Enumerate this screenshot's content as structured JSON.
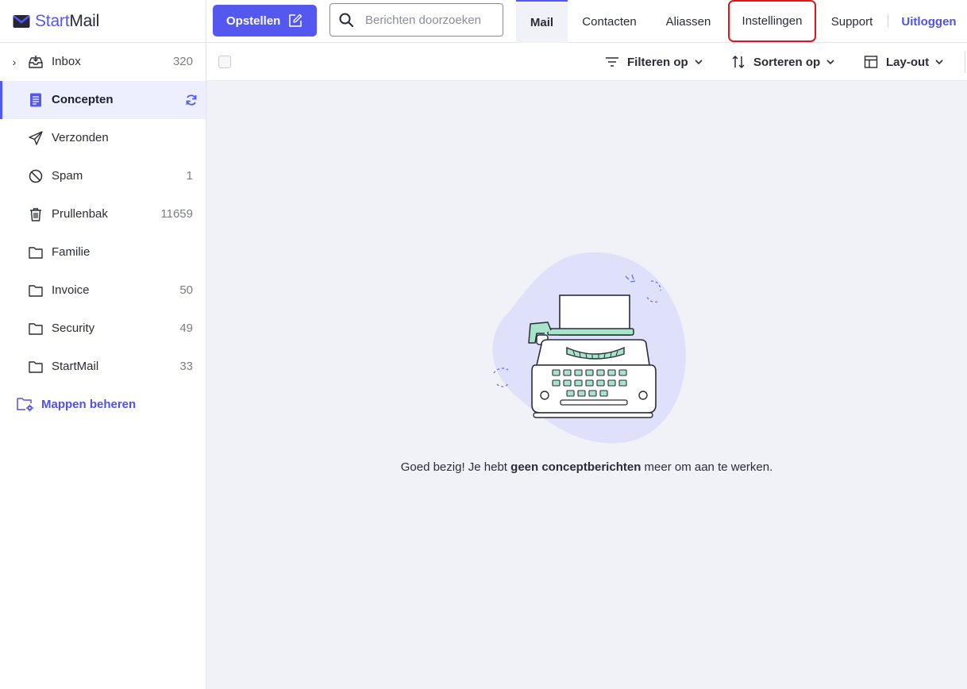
{
  "brand": {
    "name_part1": "Start",
    "name_part2": "Mail",
    "accent": "#5558ef"
  },
  "sidebar": {
    "folders": [
      {
        "label": "Inbox",
        "count": "320",
        "icon": "inbox-icon",
        "expandable": true
      },
      {
        "label": "Concepten",
        "count": "",
        "icon": "drafts-icon",
        "active": true,
        "status_icon": "sync-icon"
      },
      {
        "label": "Verzonden",
        "count": "",
        "icon": "send-icon"
      },
      {
        "label": "Spam",
        "count": "1",
        "icon": "spam-icon"
      },
      {
        "label": "Prullenbak",
        "count": "11659",
        "icon": "trash-icon"
      },
      {
        "label": "Familie",
        "count": "",
        "icon": "folder-icon"
      },
      {
        "label": "Invoice",
        "count": "50",
        "icon": "folder-icon"
      },
      {
        "label": "Security",
        "count": "49",
        "icon": "folder-icon"
      },
      {
        "label": "StartMail",
        "count": "33",
        "icon": "folder-icon"
      }
    ],
    "manage_label": "Mappen beheren"
  },
  "header": {
    "compose_label": "Opstellen",
    "search_placeholder": "Berichten doorzoeken",
    "tabs": {
      "mail": "Mail",
      "contacts": "Contacten",
      "aliases": "Aliassen",
      "settings": "Instellingen",
      "support": "Support",
      "logout": "Uitloggen"
    },
    "highlight_color": "#e0141c"
  },
  "toolbar": {
    "filter_label": "Filteren op",
    "sort_label": "Sorteren op",
    "layout_label": "Lay-out"
  },
  "main": {
    "empty_prefix": "Goed bezig! Je hebt ",
    "empty_bold": "geen conceptberichten",
    "empty_suffix": " meer om aan te werken."
  }
}
